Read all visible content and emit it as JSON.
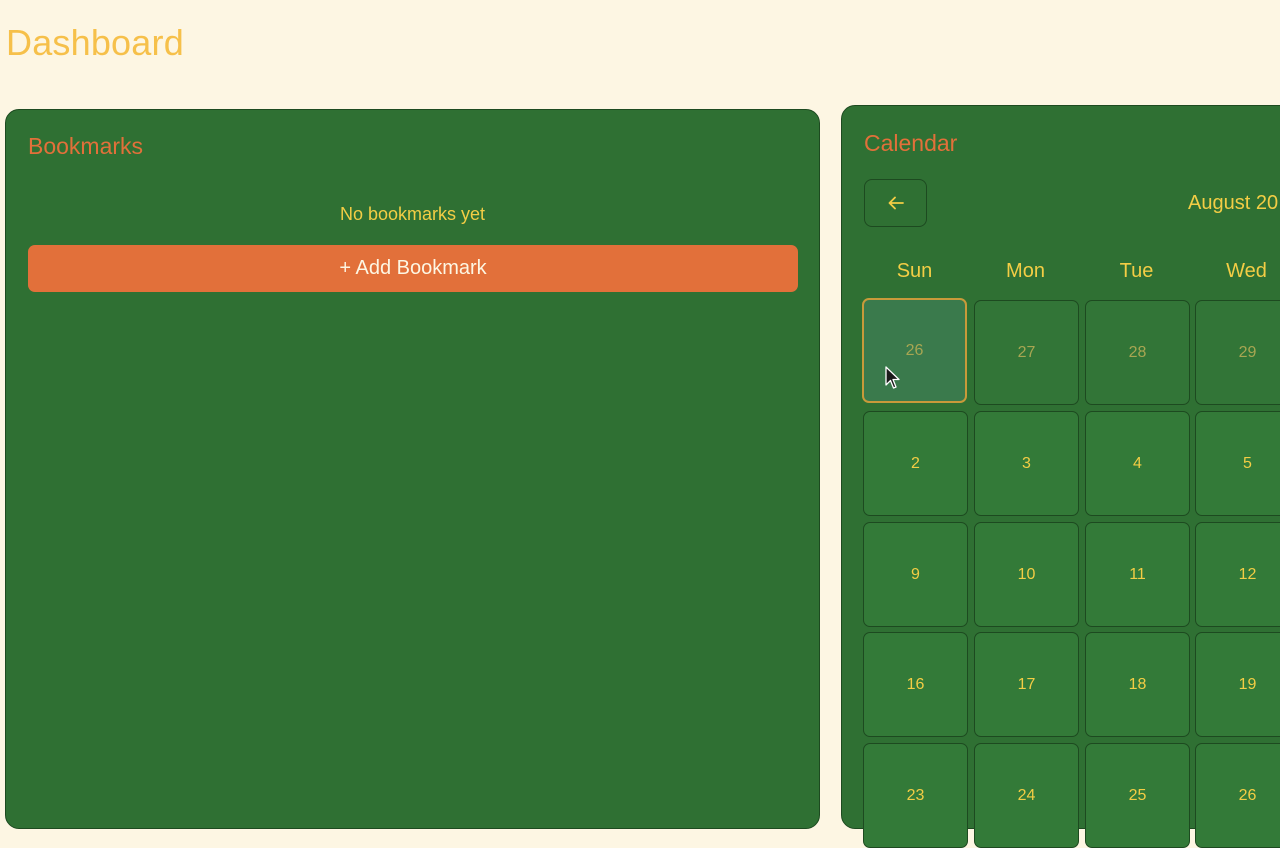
{
  "page": {
    "title": "Dashboard"
  },
  "bookmarks": {
    "title": "Bookmarks",
    "empty_text": "No bookmarks yet",
    "add_label": "+ Add Bookmark"
  },
  "calendar": {
    "title": "Calendar",
    "prev_icon": "arrow-left-icon",
    "month_label": "August 20",
    "weekdays": [
      "Sun",
      "Mon",
      "Tue",
      "Wed"
    ],
    "weeks": [
      [
        "26",
        "27",
        "28",
        "29"
      ],
      [
        "2",
        "3",
        "4",
        "5"
      ],
      [
        "9",
        "10",
        "11",
        "12"
      ],
      [
        "16",
        "17",
        "18",
        "19"
      ],
      [
        "23",
        "24",
        "25",
        "26"
      ]
    ]
  },
  "colors": {
    "background": "#fdf6e3",
    "panel": "#2f7033",
    "accent": "#e2703a",
    "text_yellow": "#f3cd45"
  }
}
